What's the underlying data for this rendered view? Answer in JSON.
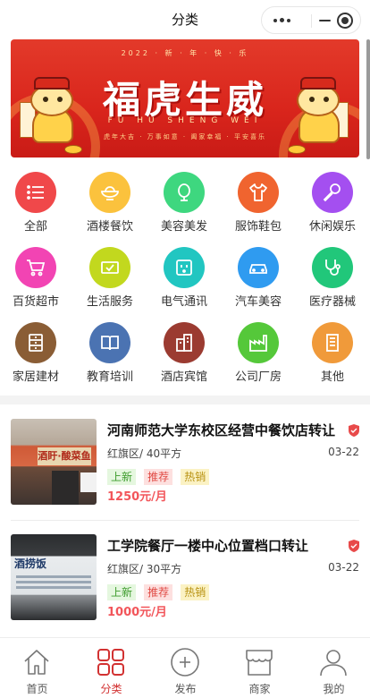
{
  "header": {
    "title": "分类"
  },
  "banner": {
    "title": "福虎生威",
    "top_text": "2022 · 新 · 年 · 快 · 乐",
    "subtitle": "FU HU SHENG WEI",
    "footer": "虎年大吉 · 万事如意 · 阖家幸福 · 平安喜乐"
  },
  "categories": [
    {
      "label": "全部",
      "icon": "list-icon",
      "color": "#f0484a"
    },
    {
      "label": "酒楼餐饮",
      "icon": "bowl-icon",
      "color": "#fbc23d"
    },
    {
      "label": "美容美发",
      "icon": "mirror-icon",
      "color": "#3ed77f"
    },
    {
      "label": "服饰鞋包",
      "icon": "shirt-icon",
      "color": "#f0642f"
    },
    {
      "label": "休闲娱乐",
      "icon": "microphone-icon",
      "color": "#a44ff0"
    },
    {
      "label": "百货超市",
      "icon": "cart-icon",
      "color": "#f244b3"
    },
    {
      "label": "生活服务",
      "icon": "ticket-icon",
      "color": "#c2d81e"
    },
    {
      "label": "电气通讯",
      "icon": "socket-icon",
      "color": "#21c6c1"
    },
    {
      "label": "汽车美容",
      "icon": "car-icon",
      "color": "#2f9bf0"
    },
    {
      "label": "医疗器械",
      "icon": "stethoscope-icon",
      "color": "#21c77a"
    },
    {
      "label": "家居建材",
      "icon": "cabinet-icon",
      "color": "#8a5d35"
    },
    {
      "label": "教育培训",
      "icon": "book-icon",
      "color": "#4b73b2"
    },
    {
      "label": "酒店宾馆",
      "icon": "hotel-icon",
      "color": "#9b3b31"
    },
    {
      "label": "公司厂房",
      "icon": "factory-icon",
      "color": "#55c83a"
    },
    {
      "label": "其他",
      "icon": "building-icon",
      "color": "#f09a3a"
    }
  ],
  "listings": [
    {
      "title": "河南师范大学东校区经营中餐饮店转让",
      "district": "红旗区",
      "area": "40平方",
      "date": "03-22",
      "tags": [
        "上新",
        "推荐",
        "热销"
      ],
      "price": "1250元/月",
      "thumb_text": "酒盱·酸菜鱼"
    },
    {
      "title": "工学院餐厅一楼中心位置档口转让",
      "district": "红旗区",
      "area": "30平方",
      "date": "03-22",
      "tags": [
        "上新",
        "推荐",
        "热销"
      ],
      "price": "1000元/月",
      "thumb_text": "酒捞饭"
    }
  ],
  "tabbar": [
    {
      "label": "首页",
      "icon": "home-icon",
      "active": false
    },
    {
      "label": "分类",
      "icon": "grid-icon",
      "active": true
    },
    {
      "label": "发布",
      "icon": "plus-circle-icon",
      "active": false
    },
    {
      "label": "商家",
      "icon": "shop-icon",
      "active": false
    },
    {
      "label": "我的",
      "icon": "user-icon",
      "active": false
    }
  ],
  "colors": {
    "accent": "#d23232",
    "price": "#f2555a"
  }
}
